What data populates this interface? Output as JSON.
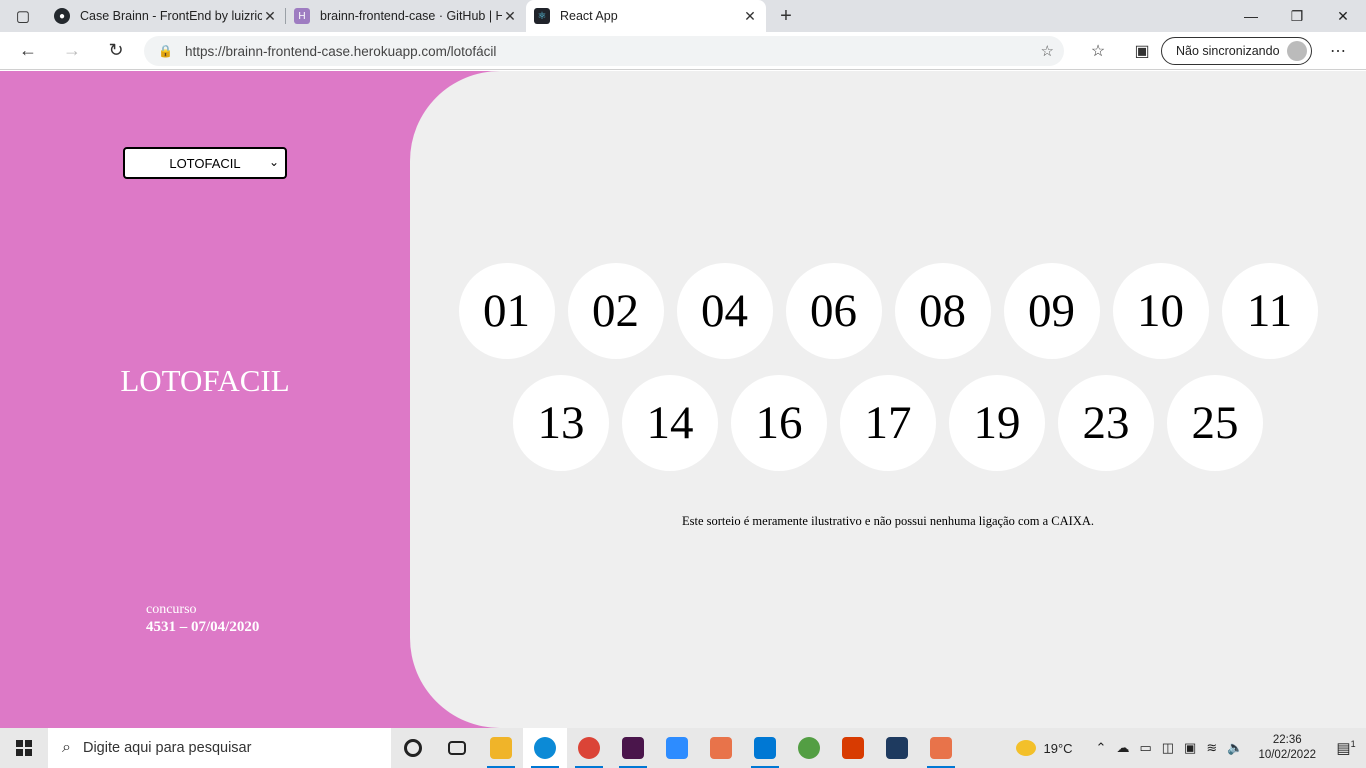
{
  "browser": {
    "tabs": [
      {
        "title": "Case Brainn - FrontEnd by luizric",
        "icon": "github-icon",
        "color": "#24292e"
      },
      {
        "title": "brainn-frontend-case · GitHub | H",
        "icon": "heroku-icon",
        "color": "#9e7cc1"
      },
      {
        "title": "React App",
        "icon": "react-icon",
        "color": "#20232a"
      }
    ],
    "address": "https://brainn-frontend-case.herokuapp.com/lotofácil",
    "sync_label": "Não sincronizando"
  },
  "sidebar": {
    "select_value": "LOTOFACIL",
    "lottery_name": "LOTOFACIL",
    "contest_label": "concurso",
    "contest_value": "4531 – 07/04/2020",
    "background": "#dd79c7"
  },
  "results": {
    "numbers": [
      "01",
      "02",
      "04",
      "06",
      "08",
      "09",
      "10",
      "11",
      "13",
      "14",
      "16",
      "17",
      "19",
      "23",
      "25"
    ],
    "disclaimer": "Este sorteio é meramente ilustrativo e não possui nenhuma ligação com a CAIXA."
  },
  "taskbar": {
    "search_placeholder": "Digite aqui para pesquisar",
    "temperature": "19°C",
    "time": "22:36",
    "date": "10/02/2022",
    "notification_count": "1",
    "apps": [
      {
        "name": "cortana-icon",
        "color": "#222222"
      },
      {
        "name": "task-view-icon",
        "color": "#222222"
      },
      {
        "name": "file-explorer-icon",
        "color": "#f0b429"
      },
      {
        "name": "edge-icon",
        "color": "#0c8ad6"
      },
      {
        "name": "chrome-icon",
        "color": "#db4437"
      },
      {
        "name": "slack-icon",
        "color": "#4a154b"
      },
      {
        "name": "zoom-icon",
        "color": "#2d8cff"
      },
      {
        "name": "gitkraken-icon",
        "color": "#e8734a"
      },
      {
        "name": "vscode-icon",
        "color": "#0078d4"
      },
      {
        "name": "nodejs-icon",
        "color": "#539e43"
      },
      {
        "name": "office-icon",
        "color": "#d83b01"
      },
      {
        "name": "sql-server-icon",
        "color": "#1e3a5f"
      },
      {
        "name": "git-icon",
        "color": "#e8734a"
      }
    ]
  }
}
